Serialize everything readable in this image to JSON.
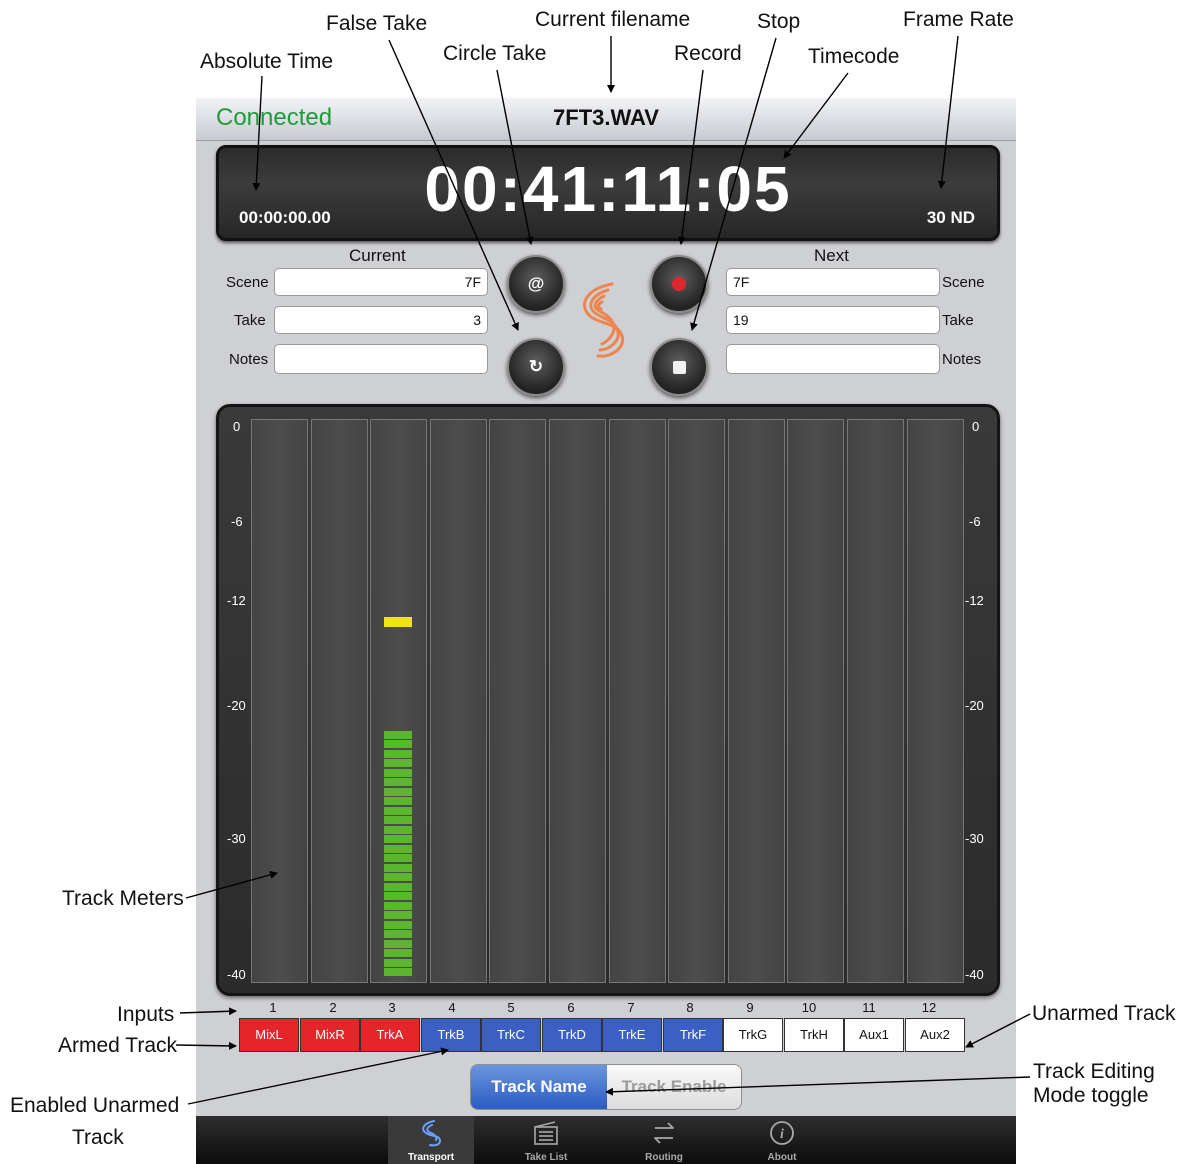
{
  "header": {
    "status": "Connected",
    "filename": "7FT3.WAV"
  },
  "timecode": {
    "absolute_time": "00:00:00.00",
    "timecode": "00:41:11:05",
    "frame_rate": "30 ND"
  },
  "current": {
    "heading": "Current",
    "scene_label": "Scene",
    "take_label": "Take",
    "notes_label": "Notes",
    "scene": "7F",
    "take": "3",
    "notes": ""
  },
  "next": {
    "heading": "Next",
    "scene_label": "Scene",
    "take_label": "Take",
    "notes_label": "Notes",
    "scene": "7F",
    "take": "19",
    "notes": ""
  },
  "buttons": {
    "circle_take_glyph": "@",
    "false_take_glyph": "↻",
    "record_icon": "record-dot",
    "stop_icon": "stop-square"
  },
  "meter_scale": [
    "0",
    "-6",
    "-12",
    "-20",
    "-30",
    "-40"
  ],
  "meters": [
    {
      "input": "1",
      "level": 0,
      "peak": null
    },
    {
      "input": "2",
      "level": 0,
      "peak": null
    },
    {
      "input": "3",
      "level": 0.45,
      "peak": 0.63
    },
    {
      "input": "4",
      "level": 0,
      "peak": null
    },
    {
      "input": "5",
      "level": 0,
      "peak": null
    },
    {
      "input": "6",
      "level": 0,
      "peak": null
    },
    {
      "input": "7",
      "level": 0,
      "peak": null
    },
    {
      "input": "8",
      "level": 0,
      "peak": null
    },
    {
      "input": "9",
      "level": 0,
      "peak": null
    },
    {
      "input": "10",
      "level": 0,
      "peak": null
    },
    {
      "input": "11",
      "level": 0,
      "peak": null
    },
    {
      "input": "12",
      "level": 0,
      "peak": null
    }
  ],
  "tracks": [
    {
      "name": "MixL",
      "state": "armed"
    },
    {
      "name": "MixR",
      "state": "armed"
    },
    {
      "name": "TrkA",
      "state": "armed"
    },
    {
      "name": "TrkB",
      "state": "enabled"
    },
    {
      "name": "TrkC",
      "state": "enabled"
    },
    {
      "name": "TrkD",
      "state": "enabled"
    },
    {
      "name": "TrkE",
      "state": "enabled"
    },
    {
      "name": "TrkF",
      "state": "enabled"
    },
    {
      "name": "TrkG",
      "state": "unarmed"
    },
    {
      "name": "TrkH",
      "state": "unarmed"
    },
    {
      "name": "Aux1",
      "state": "unarmed"
    },
    {
      "name": "Aux2",
      "state": "unarmed"
    }
  ],
  "mode_toggle": {
    "selected": "Track Name",
    "other": "Track Enable"
  },
  "tabs": [
    {
      "label": "Transport",
      "icon": "transport-icon",
      "active": true
    },
    {
      "label": "Take List",
      "icon": "take-list-icon",
      "active": false
    },
    {
      "label": "Routing",
      "icon": "routing-icon",
      "active": false
    },
    {
      "label": "About",
      "icon": "about-icon",
      "active": false
    }
  ],
  "callouts": {
    "absolute_time": "Absolute Time",
    "false_take": "False Take",
    "circle_take": "Circle Take",
    "current_filename": "Current filename",
    "record": "Record",
    "stop": "Stop",
    "timecode": "Timecode",
    "frame_rate": "Frame Rate",
    "track_meters": "Track Meters",
    "inputs": "Inputs",
    "armed_track": "Armed Track",
    "enabled_unarmed_track_line1": "Enabled Unarmed",
    "enabled_unarmed_track_line2": "Track",
    "unarmed_track": "Unarmed Track",
    "track_editing_line1": "Track Editing",
    "track_editing_line2": "Mode toggle"
  },
  "colors": {
    "connected": "#1f9b3c",
    "armed": "#e4262b",
    "enabled": "#3c5fc4",
    "meter_green": "#5bb52d",
    "meter_peak": "#f2e21b",
    "logo": "#f07a3a"
  }
}
